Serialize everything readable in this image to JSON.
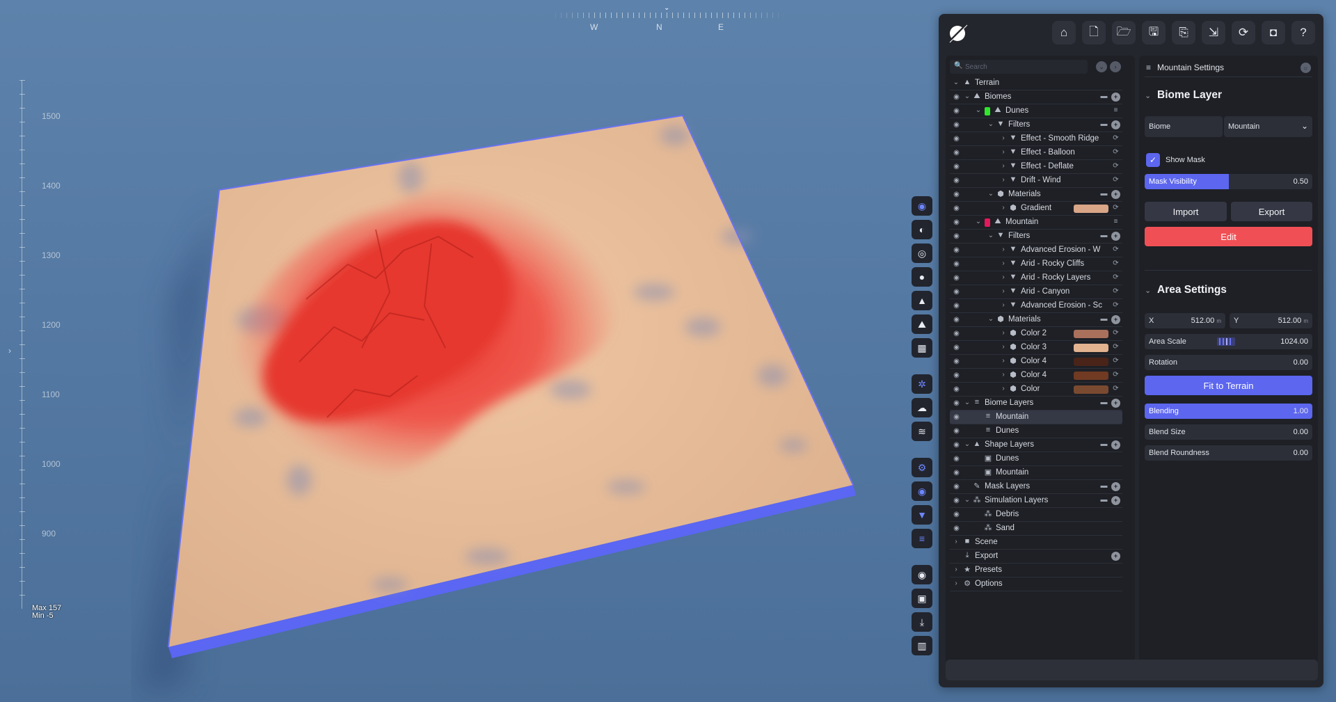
{
  "compass": {
    "w": "W",
    "n": "N",
    "e": "E"
  },
  "ruler": {
    "ticks": [
      "1500",
      "1400",
      "1300",
      "1200",
      "1100",
      "1000",
      "900"
    ],
    "max": "Max 157",
    "min": "Min -5"
  },
  "colors": {
    "accent": "#5c66ef",
    "edit_red": "#f05055",
    "terrain_sand": "#e9bf9a",
    "mask_red": "#f0524a",
    "dunes_dot": "#31e52c",
    "mountain_dot": "#e3195b"
  },
  "toolstrip": {
    "icons": [
      "sky-icon",
      "shading-icon",
      "lighting-icon",
      "water-icon",
      "terrain-icon",
      "biome-icon",
      "grid-icon",
      "snow-icon",
      "clouds-icon",
      "fog-icon",
      "settings-icon",
      "visibility-icon",
      "filter-icon",
      "layers-icon",
      "record-icon",
      "image-icon",
      "download-icon",
      "stats-icon"
    ]
  },
  "toolbar": {
    "icons": [
      "home-icon",
      "new-file-icon",
      "open-folder-icon",
      "save-icon",
      "save-as-icon",
      "export-icon",
      "refresh-icon",
      "camera-icon",
      "help-icon"
    ]
  },
  "search": {
    "placeholder": "Search"
  },
  "tree": [
    {
      "label": "Terrain",
      "icon": "terrain-icon"
    },
    {
      "label": "Biomes",
      "icon": "biome-icon"
    },
    {
      "label": "Dunes",
      "icon": "biome-icon"
    },
    {
      "label": "Filters",
      "icon": "filter-icon"
    },
    {
      "label": "Effect - Smooth Ridge",
      "icon": "filter-icon"
    },
    {
      "label": "Effect - Balloon",
      "icon": "filter-icon"
    },
    {
      "label": "Effect - Deflate",
      "icon": "filter-icon"
    },
    {
      "label": "Drift - Wind",
      "icon": "filter-icon"
    },
    {
      "label": "Materials",
      "icon": "material-icon"
    },
    {
      "label": "Gradient",
      "icon": "material-icon",
      "swatch": "#d9a687"
    },
    {
      "label": "Mountain",
      "icon": "biome-icon"
    },
    {
      "label": "Filters",
      "icon": "filter-icon"
    },
    {
      "label": "Advanced Erosion - W",
      "icon": "filter-icon"
    },
    {
      "label": "Arid - Rocky Cliffs",
      "icon": "filter-icon"
    },
    {
      "label": "Arid - Rocky Layers",
      "icon": "filter-icon"
    },
    {
      "label": "Arid - Canyon",
      "icon": "filter-icon"
    },
    {
      "label": "Advanced Erosion - Sc",
      "icon": "filter-icon"
    },
    {
      "label": "Materials",
      "icon": "material-icon"
    },
    {
      "label": "Color 2",
      "icon": "material-icon",
      "swatch": "#a9705b"
    },
    {
      "label": "Color 3",
      "icon": "material-icon",
      "swatch": "#e3b28f"
    },
    {
      "label": "Color 4",
      "icon": "material-icon",
      "swatch": "#4a2418"
    },
    {
      "label": "Color 4",
      "icon": "material-icon",
      "swatch": "#713a22"
    },
    {
      "label": "Color",
      "icon": "material-icon",
      "swatch": "#7a4a30"
    },
    {
      "label": "Biome Layers",
      "icon": "layers-icon"
    },
    {
      "label": "Mountain",
      "icon": "layers-icon"
    },
    {
      "label": "Dunes",
      "icon": "layers-icon"
    },
    {
      "label": "Shape Layers",
      "icon": "shape-icon"
    },
    {
      "label": "Dunes",
      "icon": "shape-icon"
    },
    {
      "label": "Mountain",
      "icon": "shape-icon"
    },
    {
      "label": "Mask Layers",
      "icon": "brush-icon"
    },
    {
      "label": "Simulation Layers",
      "icon": "simulation-icon"
    },
    {
      "label": "Debris",
      "icon": "simulation-icon"
    },
    {
      "label": "Sand",
      "icon": "simulation-icon"
    },
    {
      "label": "Scene",
      "icon": "camera-icon"
    },
    {
      "label": "Export",
      "icon": "download-icon"
    },
    {
      "label": "Presets",
      "icon": "star-icon"
    },
    {
      "label": "Options",
      "icon": "gear-icon"
    }
  ],
  "settings": {
    "header": "Mountain Settings",
    "biome_layer": {
      "title": "Biome Layer",
      "biome_label": "Biome",
      "biome_value": "Mountain",
      "show_mask": "Show Mask",
      "mask_visibility_label": "Mask Visibility",
      "mask_visibility_value": "0.50",
      "mask_visibility": 0.5,
      "import": "Import",
      "export": "Export",
      "edit": "Edit"
    },
    "area": {
      "title": "Area Settings",
      "x_label": "X",
      "x_value": "512.00",
      "y_label": "Y",
      "y_value": "512.00",
      "unit": "m",
      "area_scale_label": "Area Scale",
      "area_scale_value": "1024.00",
      "rotation_label": "Rotation",
      "rotation_value": "0.00",
      "fit": "Fit to Terrain",
      "blending_label": "Blending",
      "blending_value": "1.00",
      "blending": 1.0,
      "blend_size_label": "Blend Size",
      "blend_size_value": "0.00",
      "blend_roundness_label": "Blend Roundness",
      "blend_roundness_value": "0.00"
    }
  }
}
